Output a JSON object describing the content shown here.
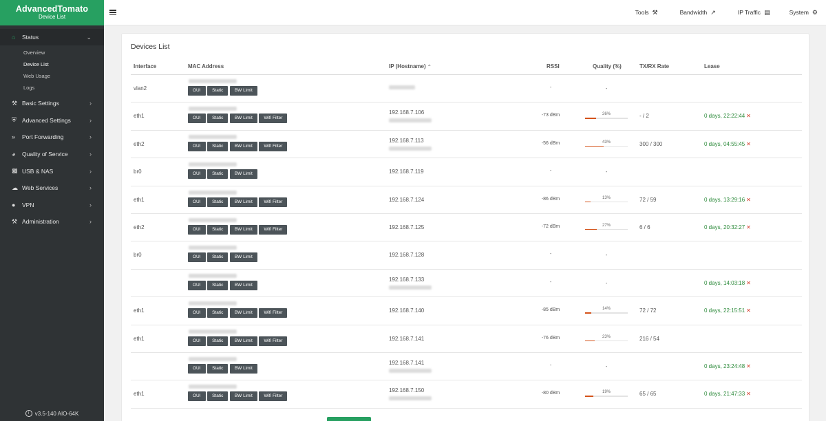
{
  "brand": {
    "title": "AdvancedTomato",
    "subtitle": "Device List"
  },
  "sidebar": {
    "items": [
      {
        "label": "Status",
        "icon": "home-icon",
        "active": true,
        "children": [
          {
            "label": "Overview"
          },
          {
            "label": "Device List",
            "current": true
          },
          {
            "label": "Web Usage"
          },
          {
            "label": "Logs"
          }
        ]
      },
      {
        "label": "Basic Settings",
        "icon": "wrench-icon"
      },
      {
        "label": "Advanced Settings",
        "icon": "shield-icon"
      },
      {
        "label": "Port Forwarding",
        "icon": "forward-icon"
      },
      {
        "label": "Quality of Service",
        "icon": "gauge-icon"
      },
      {
        "label": "USB & NAS",
        "icon": "folder-icon"
      },
      {
        "label": "Web Services",
        "icon": "cloud-icon"
      },
      {
        "label": "VPN",
        "icon": "globe-icon"
      },
      {
        "label": "Administration",
        "icon": "wrench-icon"
      }
    ],
    "footer": "v3.5-140 AIO-64K"
  },
  "topbar": {
    "menu": [
      {
        "label": "Tools",
        "icon": "tools-icon"
      },
      {
        "label": "Bandwidth",
        "icon": "chart-line-icon"
      },
      {
        "label": "IP Traffic",
        "icon": "chart-area-icon"
      },
      {
        "label": "System",
        "icon": "gear-icon"
      }
    ]
  },
  "main": {
    "title": "Devices List",
    "columns": {
      "interface": "Interface",
      "mac": "MAC Address",
      "ip": "IP (Hostname)",
      "rssi": "RSSI",
      "quality": "Quality (%)",
      "txrx": "TX/RX Rate",
      "lease": "Lease"
    },
    "buttons": {
      "oui": "OUI",
      "static": "Static",
      "bw": "BW Limit",
      "wifi": "Wifi Filter"
    },
    "rows": [
      {
        "iface": "vlan2",
        "ip": "",
        "ip_blur": true,
        "host": false,
        "rssi": "-",
        "quality": null,
        "txrx": "",
        "lease": "",
        "wifi": false
      },
      {
        "iface": "eth1",
        "ip": "192.168.7.106",
        "host": true,
        "rssi": "-73 dBm",
        "quality": 26,
        "txrx": "- / 2",
        "lease": "0 days, 22:22:44",
        "wifi": true
      },
      {
        "iface": "eth2",
        "ip": "192.168.7.113",
        "host": true,
        "rssi": "-56 dBm",
        "quality": 43,
        "txrx": "300 / 300",
        "lease": "0 days, 04:55:45",
        "wifi": true
      },
      {
        "iface": "br0",
        "ip": "192.168.7.119",
        "host": false,
        "rssi": "-",
        "quality": null,
        "txrx": "",
        "lease": "",
        "wifi": false
      },
      {
        "iface": "eth1",
        "ip": "192.168.7.124",
        "host": false,
        "rssi": "-86 dBm",
        "quality": 13,
        "txrx": "72 / 59",
        "lease": "0 days, 13:29:16",
        "wifi": true
      },
      {
        "iface": "eth2",
        "ip": "192.168.7.125",
        "host": false,
        "rssi": "-72 dBm",
        "quality": 27,
        "txrx": "6 / 6",
        "lease": "0 days, 20:32:27",
        "wifi": true
      },
      {
        "iface": "br0",
        "ip": "192.168.7.128",
        "host": false,
        "rssi": "-",
        "quality": null,
        "txrx": "",
        "lease": "",
        "wifi": false
      },
      {
        "iface": "",
        "ip": "192.168.7.133",
        "host": true,
        "rssi": "-",
        "quality": null,
        "txrx": "",
        "lease": "0 days, 14:03:18",
        "wifi": false
      },
      {
        "iface": "eth1",
        "ip": "192.168.7.140",
        "host": false,
        "rssi": "-85 dBm",
        "quality": 14,
        "txrx": "72 / 72",
        "lease": "0 days, 22:15:51",
        "wifi": true
      },
      {
        "iface": "eth1",
        "ip": "192.168.7.141",
        "host": false,
        "rssi": "-76 dBm",
        "quality": 23,
        "txrx": "216 / 54",
        "lease": "",
        "wifi": true
      },
      {
        "iface": "",
        "ip": "192.168.7.141",
        "host": true,
        "rssi": "-",
        "quality": null,
        "txrx": "",
        "lease": "0 days, 23:24:48",
        "wifi": false
      },
      {
        "iface": "eth1",
        "ip": "192.168.7.150",
        "host": true,
        "rssi": "-80 dBm",
        "quality": 19,
        "txrx": "65 / 65",
        "lease": "0 days, 21:47:33",
        "wifi": true
      }
    ]
  },
  "colors": {
    "accent": "#27a061",
    "sidebar": "#2f3335",
    "quality_bar": "#d4531a",
    "lease_text": "#2e8b3c",
    "remove_x": "#d43b2a"
  }
}
